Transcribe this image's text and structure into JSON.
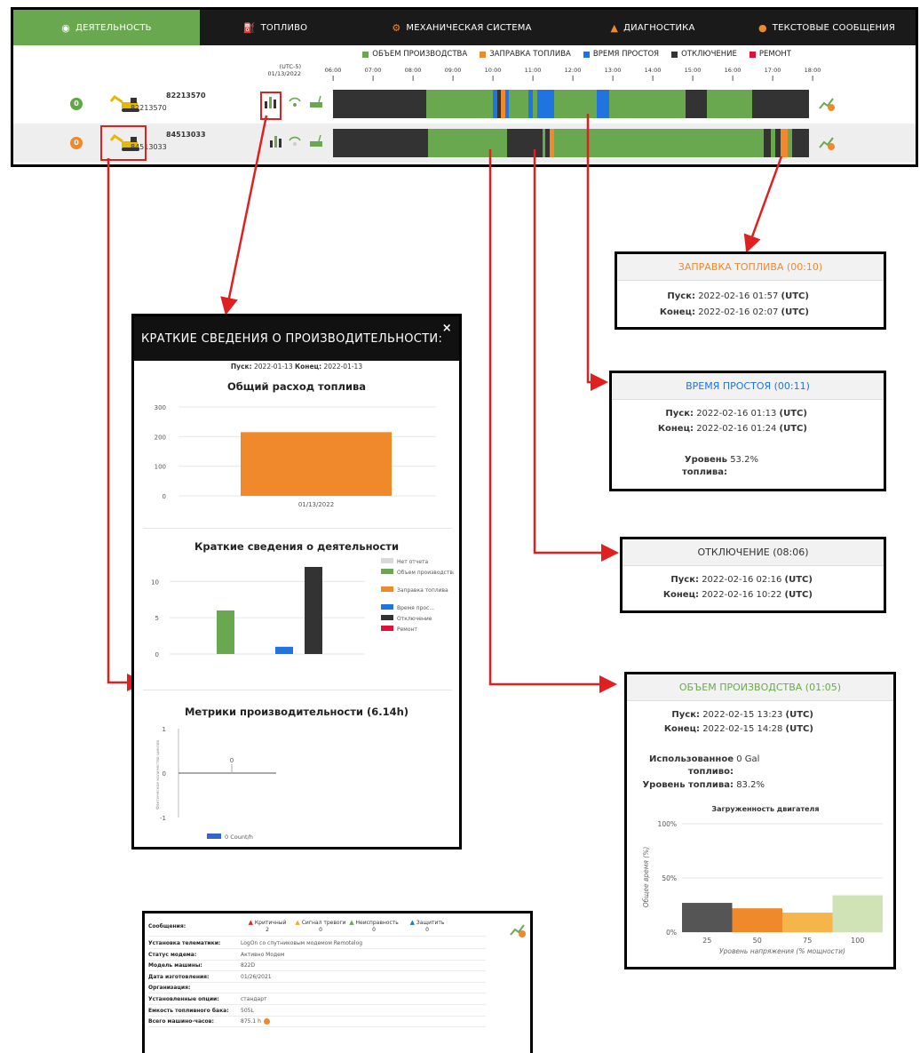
{
  "tabs": [
    {
      "label": "ДЕЯТЕЛЬНОСТЬ",
      "icon": "dashboard-icon"
    },
    {
      "label": "ТОПЛИВО",
      "icon": "fuel-icon"
    },
    {
      "label": "МЕХАНИЧЕСКАЯ СИСТЕМА",
      "icon": "gears-icon"
    },
    {
      "label": "ДИАГНОСТИКА",
      "icon": "warning-icon"
    },
    {
      "label": "ТЕКСТОВЫЕ СООБЩЕНИЯ",
      "icon": "chat-icon"
    }
  ],
  "legend": [
    {
      "label": "ОБЪЕМ ПРОИЗВОДСТВА",
      "color": "#6aa84f"
    },
    {
      "label": "ЗАПРАВКА ТОПЛИВА",
      "color": "#f0892b"
    },
    {
      "label": "ВРЕМЯ ПРОСТОЯ",
      "color": "#1f74e0"
    },
    {
      "label": "ОТКЛЮЧЕНИЕ",
      "color": "#333333"
    },
    {
      "label": "РЕМОНТ",
      "color": "#e0103a"
    }
  ],
  "timeline": {
    "timezone": "(UTC-5)",
    "date": "01/13/2022",
    "hours": [
      "06:00",
      "07:00",
      "08:00",
      "09:00",
      "10:00",
      "11:00",
      "12:00",
      "13:00",
      "14:00",
      "15:00",
      "16:00",
      "17:00",
      "18:00"
    ]
  },
  "machines": [
    {
      "name": "82213570",
      "id": "82213570",
      "status_number": "0",
      "status_color": "#5fa845",
      "segments": [
        {
          "start": 0.0,
          "end": 0.195,
          "kind": "off"
        },
        {
          "start": 0.195,
          "end": 0.335,
          "kind": "prod"
        },
        {
          "start": 0.335,
          "end": 0.345,
          "kind": "idle"
        },
        {
          "start": 0.345,
          "end": 0.352,
          "kind": "off"
        },
        {
          "start": 0.352,
          "end": 0.362,
          "kind": "fuel"
        },
        {
          "start": 0.362,
          "end": 0.37,
          "kind": "idle"
        },
        {
          "start": 0.37,
          "end": 0.41,
          "kind": "prod"
        },
        {
          "start": 0.41,
          "end": 0.42,
          "kind": "idle"
        },
        {
          "start": 0.42,
          "end": 0.43,
          "kind": "prod"
        },
        {
          "start": 0.43,
          "end": 0.465,
          "kind": "idle"
        },
        {
          "start": 0.465,
          "end": 0.555,
          "kind": "prod"
        },
        {
          "start": 0.555,
          "end": 0.58,
          "kind": "idle"
        },
        {
          "start": 0.58,
          "end": 0.74,
          "kind": "prod"
        },
        {
          "start": 0.74,
          "end": 0.785,
          "kind": "off"
        },
        {
          "start": 0.785,
          "end": 0.88,
          "kind": "prod"
        },
        {
          "start": 0.88,
          "end": 1.0,
          "kind": "off"
        }
      ]
    },
    {
      "name": "84513033",
      "id": "84513033",
      "status_number": "0",
      "status_color": "#f0892b",
      "segments": [
        {
          "start": 0.0,
          "end": 0.2,
          "kind": "off"
        },
        {
          "start": 0.2,
          "end": 0.365,
          "kind": "prod"
        },
        {
          "start": 0.365,
          "end": 0.44,
          "kind": "off"
        },
        {
          "start": 0.44,
          "end": 0.445,
          "kind": "prod"
        },
        {
          "start": 0.445,
          "end": 0.455,
          "kind": "off"
        },
        {
          "start": 0.455,
          "end": 0.465,
          "kind": "fuel"
        },
        {
          "start": 0.465,
          "end": 0.905,
          "kind": "prod"
        },
        {
          "start": 0.905,
          "end": 0.92,
          "kind": "off"
        },
        {
          "start": 0.92,
          "end": 0.93,
          "kind": "prod"
        },
        {
          "start": 0.93,
          "end": 0.94,
          "kind": "off"
        },
        {
          "start": 0.94,
          "end": 0.955,
          "kind": "fuel"
        },
        {
          "start": 0.955,
          "end": 0.965,
          "kind": "prod"
        },
        {
          "start": 0.965,
          "end": 1.0,
          "kind": "off"
        }
      ]
    }
  ],
  "colors": {
    "prod": "#6aa84f",
    "fuel": "#f0892b",
    "idle": "#1f74e0",
    "off": "#333333",
    "repair": "#e0103a",
    "annot": "#e02020"
  },
  "popups": {
    "fuel": {
      "title": "ЗАПРАВКА ТОПЛИВА (00:10)",
      "start_label": "Пуск:",
      "start": "2022-02-16 01:57",
      "end_label": "Конец:",
      "end": "2022-02-16 02:07",
      "utc": "(UTC)"
    },
    "idle": {
      "title": "ВРЕМЯ ПРОСТОЯ (00:11)",
      "start_label": "Пуск:",
      "start": "2022-02-16 01:13",
      "end_label": "Конец:",
      "end": "2022-02-16 01:24",
      "utc": "(UTC)",
      "fuel_level_label_1": "Уровень",
      "fuel_level_label_2": "топлива:",
      "fuel_level": "53.2%"
    },
    "off": {
      "title": "ОТКЛЮЧЕНИЕ (08:06)",
      "start_label": "Пуск:",
      "start": "2022-02-16 02:16",
      "end_label": "Конец:",
      "end": "2022-02-16 10:22",
      "utc": "(UTC)"
    },
    "prod": {
      "title": "ОБЪЕМ ПРОИЗВОДСТВА (01:05)",
      "start_label": "Пуск:",
      "start": "2022-02-15 13:23",
      "end_label": "Конец:",
      "end": "2022-02-15 14:28",
      "utc": "(UTC)",
      "used_fuel_label_1": "Использованное",
      "used_fuel_label_2": "топливо:",
      "used_fuel": "0 Gal",
      "fuel_level_label": "Уровень топлива:",
      "fuel_level": "83.2%"
    }
  },
  "modal": {
    "title": "КРАТКИЕ СВЕДЕНИЯ О ПРОИЗВОДИТЕЛЬНОСТИ:",
    "close": "×",
    "start_label": "Пуск:",
    "start": "2022-01-13",
    "end_label": "Конец:",
    "end": "2022-01-13",
    "fuel_title": "Общий расход топлива",
    "activity_title": "Краткие сведения о деятельности",
    "metrics_title": "Метрики производительности (6.14h)"
  },
  "chart_data": [
    {
      "type": "bar",
      "title": "Общий расход топлива",
      "categories": [
        "01/13/2022"
      ],
      "values": [
        215
      ],
      "ylim": [
        0,
        300
      ],
      "yticks": [
        0,
        100,
        200,
        300
      ],
      "color": "#f0892b"
    },
    {
      "type": "bar",
      "title": "Краткие сведения о деятельности",
      "ylim": [
        0,
        12
      ],
      "yticks": [
        0,
        5,
        10
      ],
      "series": [
        {
          "name": "Нет отчета",
          "value": 0,
          "color": "#d9d9d9"
        },
        {
          "name": "Объем производства",
          "value": 6,
          "color": "#6aa84f"
        },
        {
          "name": "Заправка топлива",
          "value": 0,
          "color": "#f0892b"
        },
        {
          "name": "Время прос...",
          "value": 1,
          "color": "#1f74e0"
        },
        {
          "name": "Отключение",
          "value": 12,
          "color": "#333333"
        },
        {
          "name": "Ремонт",
          "value": 0,
          "color": "#e0103a"
        }
      ]
    },
    {
      "type": "bar",
      "title": "Метрики производительности (6.14h)",
      "ylabel": "Фактическое количество циклов",
      "ylim": [
        -1,
        1
      ],
      "yticks": [
        -1,
        0,
        1
      ],
      "values": [
        0
      ],
      "data_label": "0",
      "series": [
        {
          "name": "0 Count/h",
          "color": "#3366cc"
        }
      ]
    },
    {
      "type": "bar",
      "title": "Загруженность двигателя",
      "xlabel": "Уровень напряжения (% мощности)",
      "ylabel": "Общее время (%)",
      "categories": [
        "25",
        "50",
        "75",
        "100"
      ],
      "values": [
        27,
        22,
        18,
        34
      ],
      "ylim": [
        0,
        100
      ],
      "yticks": [
        "0%",
        "50%",
        "100%"
      ],
      "colors": [
        "#555555",
        "#f0892b",
        "#f6b54b",
        "#cfe3b6"
      ]
    }
  ],
  "info": {
    "messages_label": "Сообщения:",
    "alarms": [
      {
        "label": "Критичный",
        "count": "2",
        "color": "#e02020"
      },
      {
        "label": "Сигнал тревоги",
        "count": "0",
        "color": "#f0b020"
      },
      {
        "label": "Неисправность",
        "count": "0",
        "color": "#6aa84f"
      },
      {
        "label": "Защитить",
        "count": "0",
        "color": "#1f74e0"
      }
    ],
    "rows": [
      {
        "label": "Установка телематики:",
        "value": "LogOn со спутниковым модемом Remotelog"
      },
      {
        "label": "Статус модема:",
        "value": "Активно Модем"
      },
      {
        "label": "Модель машины:",
        "value": "822D"
      },
      {
        "label": "Дата изготовления:",
        "value": "01/26/2021"
      },
      {
        "label": "Организация:",
        "value": ""
      },
      {
        "label": "Установленные опции:",
        "value": "стандарт"
      },
      {
        "label": "Емкость топливного бака:",
        "value": "505L"
      },
      {
        "label": "Всего машино-часов:",
        "value": "875.1 h"
      }
    ]
  }
}
